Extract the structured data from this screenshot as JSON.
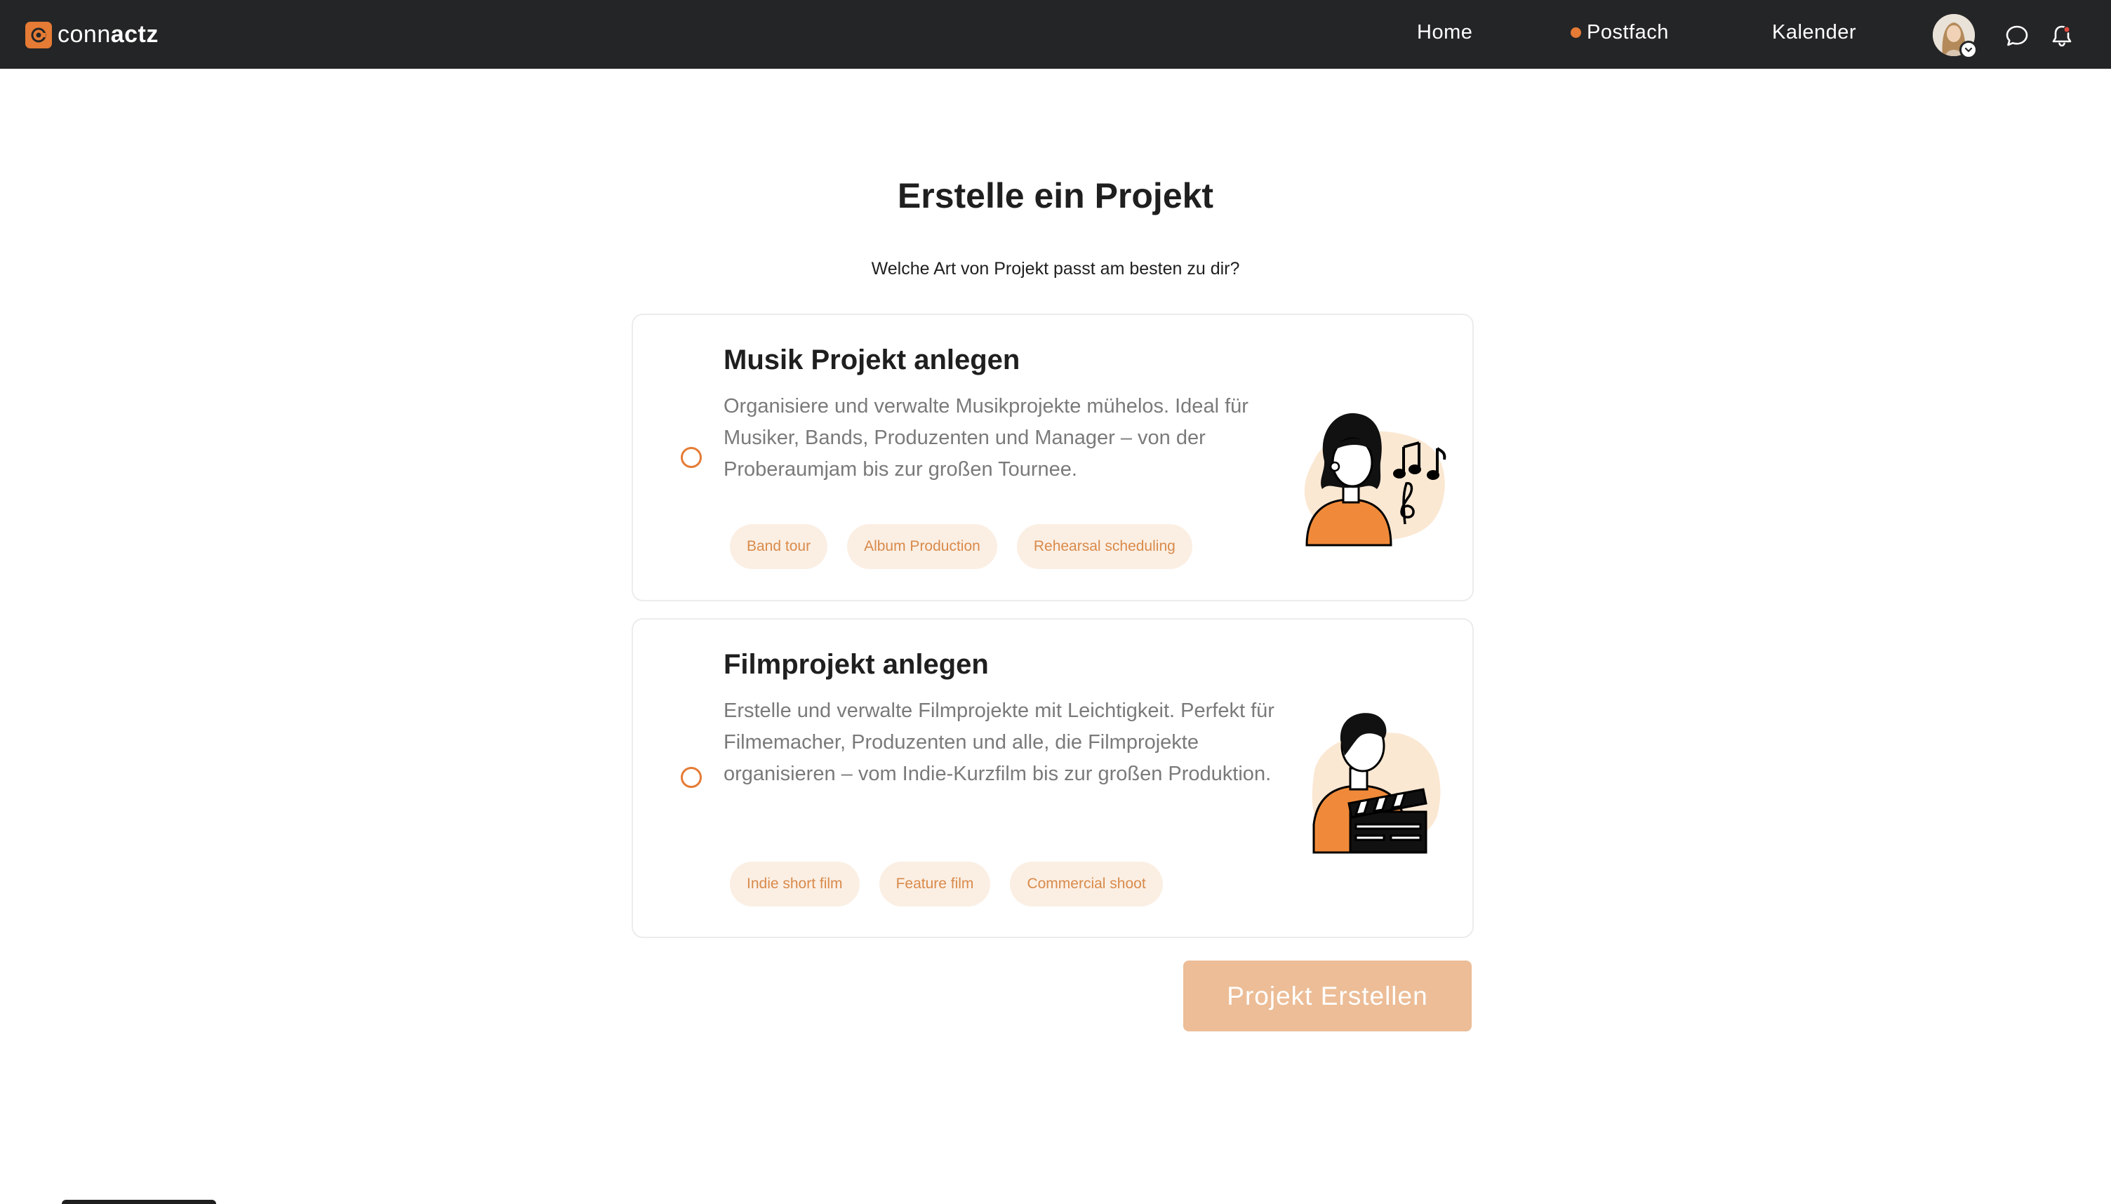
{
  "colors": {
    "topbar": "#242526",
    "accent": "#e57b34",
    "tag_bg": "#fbefe4",
    "tag_text": "#d98a4a",
    "cta_bg": "#ecbd97"
  },
  "brand": {
    "name_light": "conn",
    "name_bold": "actz",
    "icon": "logo-mark-icon"
  },
  "nav": {
    "home": "Home",
    "postfach": "Postfach",
    "kalender": "Kalender"
  },
  "header_icons": [
    "avatar",
    "chat-icon",
    "bell-icon"
  ],
  "page": {
    "title": "Erstelle ein Projekt",
    "subtitle": "Welche Art von Projekt passt am besten zu dir?"
  },
  "options": [
    {
      "title": "Musik Projekt anlegen",
      "description": "Organisiere und verwalte Musikprojekte mühelos. Ideal für Musiker, Bands, Produzenten und Manager – von der Proberaumjam bis zur großen Tournee.",
      "tags": [
        "Band tour",
        "Album Production",
        "Rehearsal scheduling"
      ],
      "selected": false,
      "illustration": "musician-illustration"
    },
    {
      "title": "Filmprojekt anlegen",
      "description": "Erstelle und verwalte Filmprojekte mit Leichtigkeit. Perfekt für Filmemacher, Produzenten und alle, die Filmprojekte organisieren – vom Indie-Kurzfilm bis zur großen Produktion.",
      "tags": [
        "Indie short film",
        "Feature film",
        "Commercial shoot"
      ],
      "selected": false,
      "illustration": "filmmaker-illustration"
    }
  ],
  "cta": {
    "label": "Projekt Erstellen",
    "disabled": true
  }
}
